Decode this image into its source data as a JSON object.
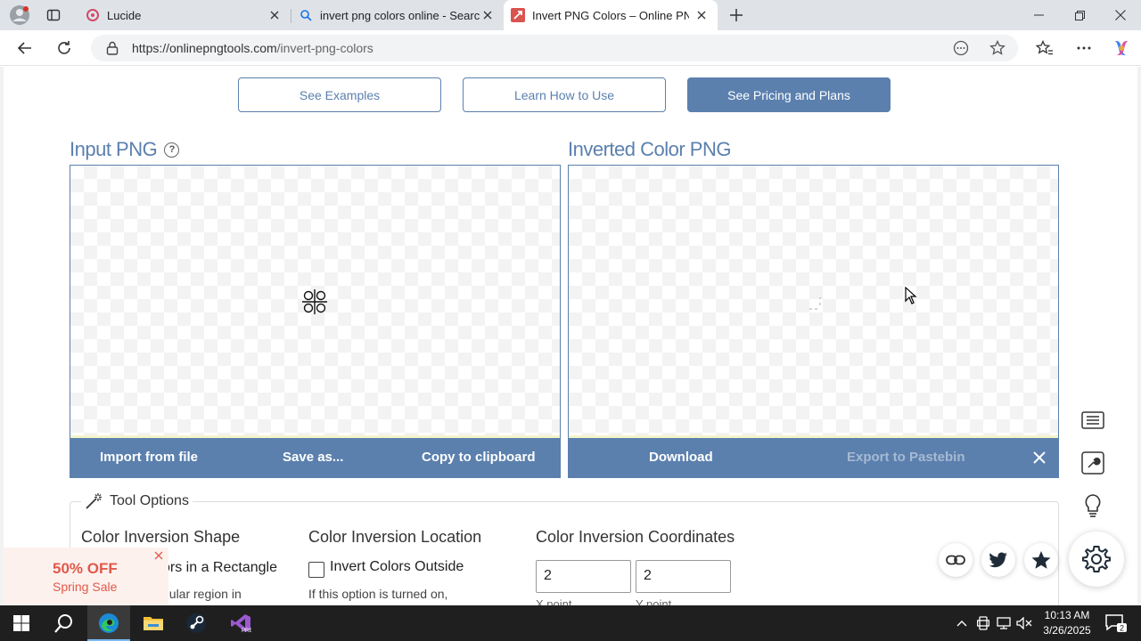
{
  "browser": {
    "tabs": [
      {
        "title": "Lucide",
        "active": false
      },
      {
        "title": "invert png colors online - Search",
        "active": false
      },
      {
        "title": "Invert PNG Colors – Online PNG Maker",
        "active": true
      }
    ],
    "url": {
      "host": "https://onlinepngtools.com",
      "path": "/invert-png-colors"
    }
  },
  "page": {
    "top_buttons": {
      "examples": "See Examples",
      "learn": "Learn How to Use",
      "pricing": "See Pricing and Plans"
    },
    "input_panel": {
      "title": "Input PNG",
      "help": "?",
      "actions": {
        "import": "Import from file",
        "save": "Save as...",
        "copy": "Copy to clipboard"
      }
    },
    "output_panel": {
      "title": "Inverted Color PNG",
      "actions": {
        "download": "Download",
        "export": "Export to Pastebin"
      }
    },
    "tool_options": {
      "legend": "Tool Options",
      "shape": {
        "heading": "Color Inversion Shape",
        "option": "ors in a Rectangle",
        "desc": "gular region in"
      },
      "location": {
        "heading": "Color Inversion Location",
        "option": "Invert Colors Outside",
        "desc": "If this option is turned on,"
      },
      "coordinates": {
        "heading": "Color Inversion Coordinates",
        "x_value": "2",
        "y_value": "2",
        "x_label": "X point",
        "y_label": "Y point"
      }
    },
    "promo": {
      "line1": "50% OFF",
      "line2": "Spring Sale"
    }
  },
  "taskbar": {
    "clock_time": "10:13 AM",
    "clock_date": "3/26/2025",
    "notification_count": "2"
  },
  "colors": {
    "accent": "#5b80ae",
    "promo": "#e0594a"
  }
}
